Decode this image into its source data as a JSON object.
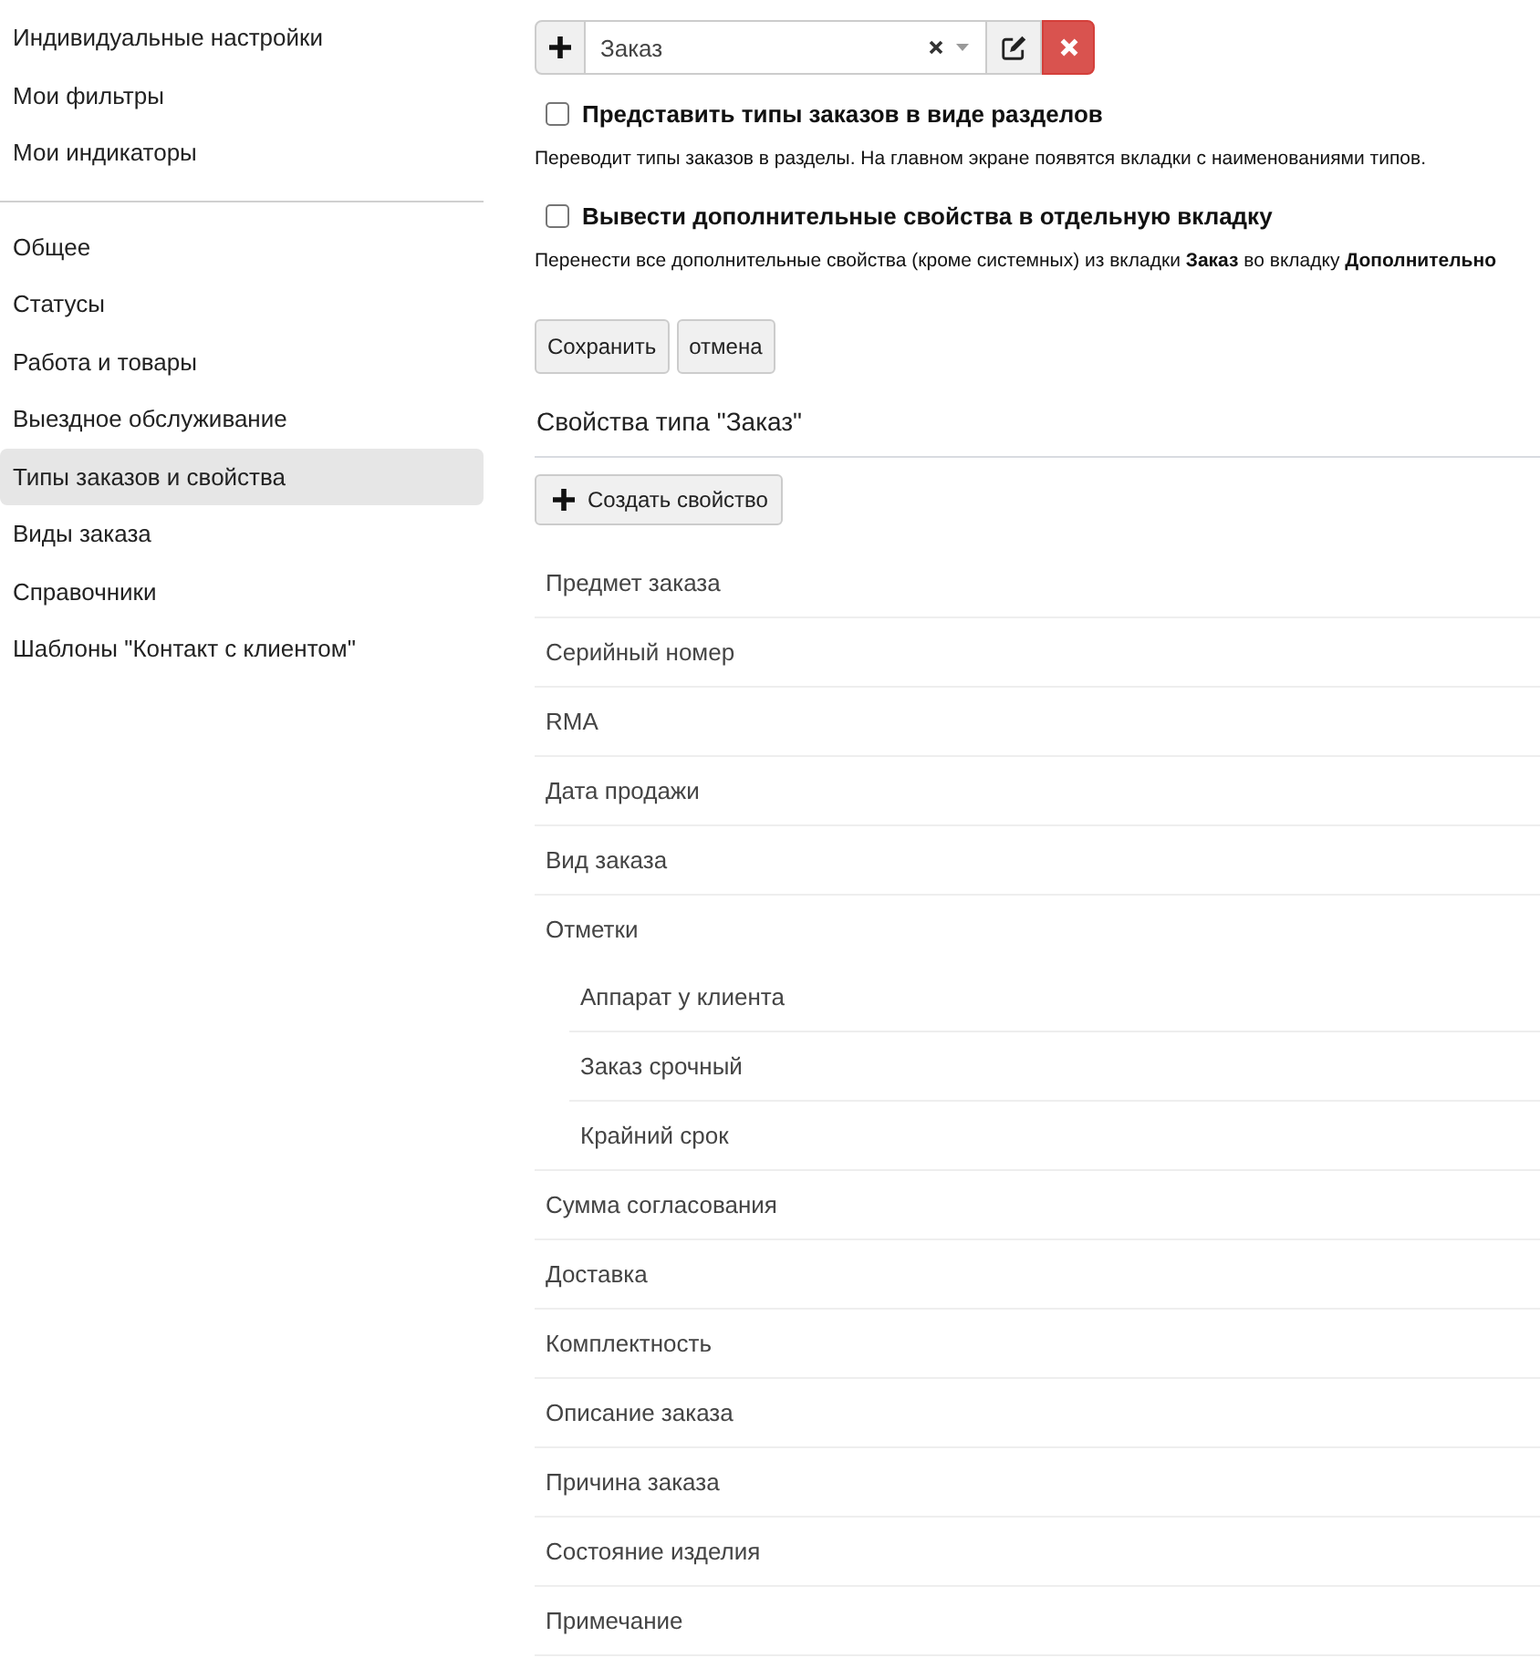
{
  "sidebar": {
    "groups": [
      {
        "items": [
          {
            "label": "Индивидуальные настройки",
            "selected": false
          },
          {
            "label": "Мои фильтры",
            "selected": false
          },
          {
            "label": "Мои индикаторы",
            "selected": false
          }
        ]
      },
      {
        "items": [
          {
            "label": "Общее",
            "selected": false
          },
          {
            "label": "Статусы",
            "selected": false
          },
          {
            "label": "Работа и товары",
            "selected": false
          },
          {
            "label": "Выездное обслуживание",
            "selected": false
          },
          {
            "label": "Типы заказов и свойства",
            "selected": true
          },
          {
            "label": "Виды заказа",
            "selected": false
          },
          {
            "label": "Справочники",
            "selected": false
          },
          {
            "label": "Шаблоны \"Контакт с клиентом\"",
            "selected": false
          }
        ]
      }
    ]
  },
  "toolbar": {
    "type_select": {
      "value": "Заказ"
    }
  },
  "options": [
    {
      "label": "Представить типы заказов в виде разделов",
      "checked": false,
      "description": "Переводит типы заказов в разделы. На главном экране появятся вкладки с наименованиями типов."
    },
    {
      "label": "Вывести дополнительные свойства в отдельную вкладку",
      "checked": false,
      "description": "Перенести все дополнительные свойства (кроме системных) из вкладки **Заказ** во вкладку **Дополнительно**"
    }
  ],
  "form_buttons": [
    "Сохранить",
    "отмена"
  ],
  "properties": {
    "title": "Свойства типа \"Заказ\"",
    "create_button": "Создать свойство",
    "items": [
      {
        "label": "Предмет заказа"
      },
      {
        "label": "Серийный номер"
      },
      {
        "label": "RMA"
      },
      {
        "label": "Дата продажи"
      },
      {
        "label": "Вид заказа"
      },
      {
        "label": "Отметки",
        "children": [
          {
            "label": "Аппарат у клиента"
          },
          {
            "label": "Заказ срочный"
          },
          {
            "label": "Крайний срок"
          }
        ]
      },
      {
        "label": "Сумма согласования"
      },
      {
        "label": "Доставка"
      },
      {
        "label": "Комплектность"
      },
      {
        "label": "Описание заказа"
      },
      {
        "label": "Причина заказа"
      },
      {
        "label": "Состояние изделия"
      },
      {
        "label": "Примечание"
      }
    ]
  }
}
